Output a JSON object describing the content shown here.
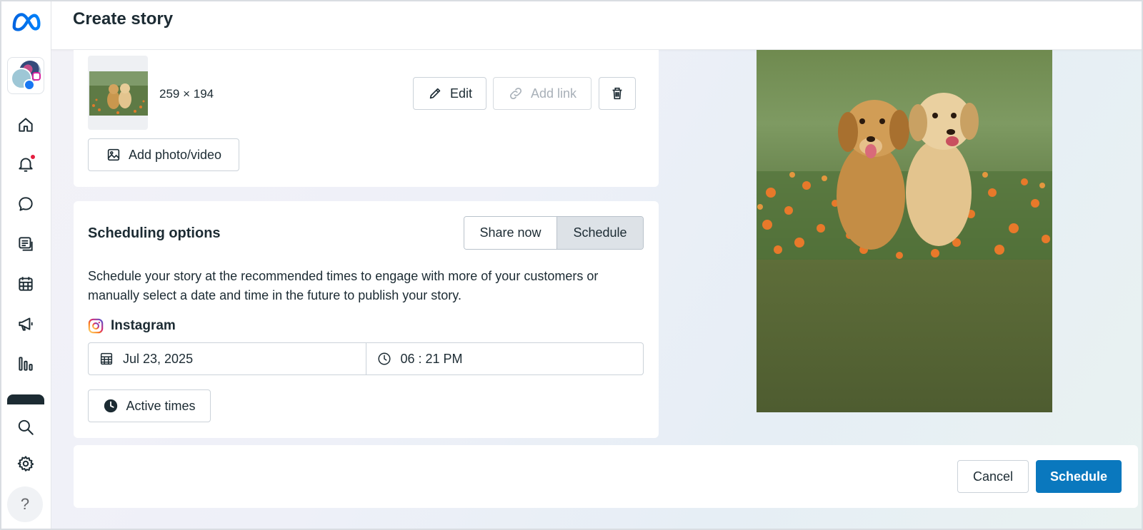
{
  "header": {
    "title": "Create story"
  },
  "sidebar": {
    "items": [
      {
        "name": "home",
        "icon": "home-icon"
      },
      {
        "name": "notifications",
        "icon": "bell-icon",
        "has_badge": true
      },
      {
        "name": "inbox",
        "icon": "chat-bubble-icon"
      },
      {
        "name": "content",
        "icon": "content-icon"
      },
      {
        "name": "planner",
        "icon": "calendar-icon"
      },
      {
        "name": "ads",
        "icon": "megaphone-icon"
      },
      {
        "name": "insights",
        "icon": "bar-chart-icon"
      },
      {
        "name": "search",
        "icon": "search-icon"
      },
      {
        "name": "settings",
        "icon": "gear-icon"
      }
    ],
    "help_label": "?"
  },
  "media": {
    "size_label": "259 × 194",
    "edit_label": "Edit",
    "add_link_label": "Add link",
    "add_photo_label": "Add photo/video"
  },
  "scheduling": {
    "title": "Scheduling options",
    "share_now_label": "Share now",
    "schedule_label": "Schedule",
    "selected": "Schedule",
    "description": "Schedule your story at the recommended times to engage with more of your customers or manually select a date and time in the future to publish your story.",
    "platform": "Instagram",
    "date": "Jul 23, 2025",
    "time": "06 : 21 PM",
    "active_times_label": "Active times"
  },
  "footer": {
    "cancel_label": "Cancel",
    "schedule_label": "Schedule"
  },
  "colors": {
    "primary": "#0a78be",
    "notification": "#e41e3f",
    "text": "#1c2b33"
  }
}
